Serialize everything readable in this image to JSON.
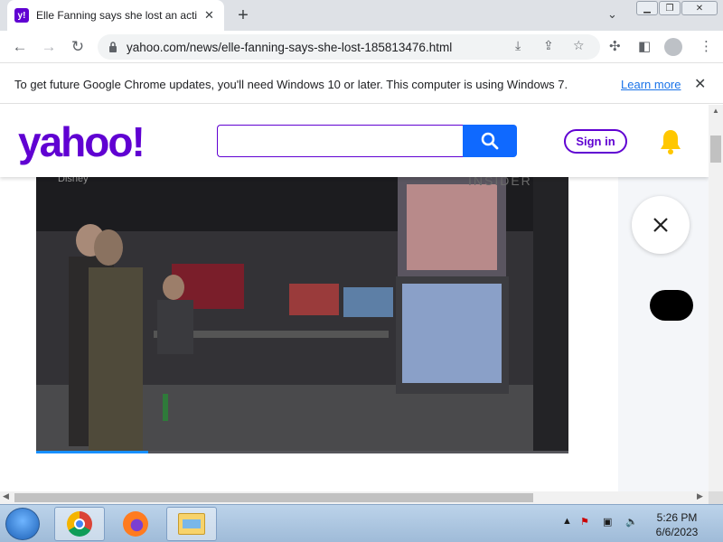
{
  "browser": {
    "tab": {
      "title": "Elle Fanning says she lost an acti",
      "favicon_label": "y!"
    },
    "url": "yahoo.com/news/elle-fanning-says-she-lost-185813476.html"
  },
  "infobar": {
    "message": "To get future Google Chrome updates, you'll need Windows 10 or later. This computer is using Windows 7.",
    "link": "Learn more"
  },
  "yahoo": {
    "logo": "yahoo!",
    "search_placeholder": "",
    "signin_label": "Sign in"
  },
  "video": {
    "credit": "Disney",
    "watermark": "INSIDER",
    "progress_fraction": 0.21
  },
  "taskbar": {
    "time": "5:26 PM",
    "date": "6/6/2023"
  },
  "colors": {
    "brand_purple": "#6001d2",
    "search_blue": "#0f69ff",
    "bell_yellow": "#ffc700"
  }
}
